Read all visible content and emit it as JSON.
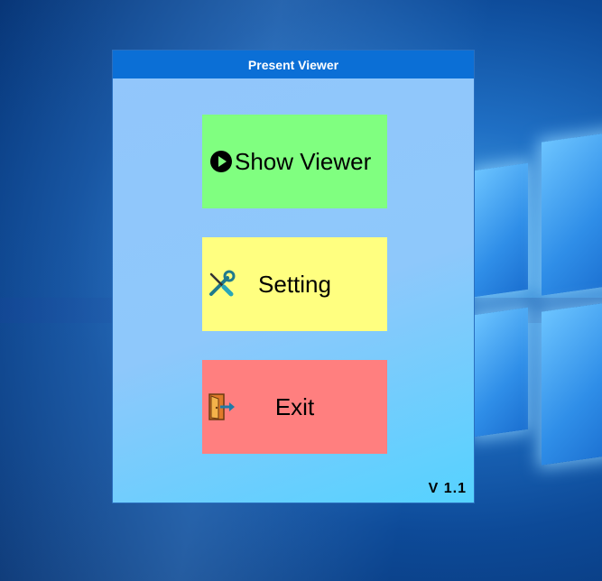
{
  "window": {
    "title": "Present Viewer",
    "version": "V  1.1"
  },
  "buttons": {
    "show_viewer": {
      "label": "Show Viewer",
      "icon": "play-circle-icon",
      "color": "#80ff80"
    },
    "setting": {
      "label": "Setting",
      "icon": "tools-icon",
      "color": "#ffff80"
    },
    "exit": {
      "label": "Exit",
      "icon": "exit-door-icon",
      "color": "#ff7f7f"
    }
  }
}
